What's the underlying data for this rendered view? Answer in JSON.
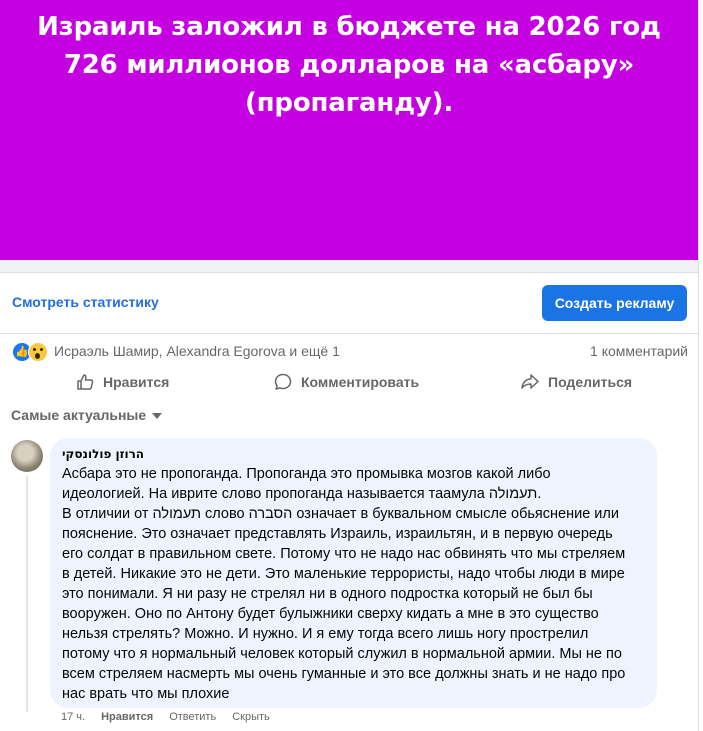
{
  "banner": {
    "color": "#c501e2",
    "line1": "Израиль заложил в бюджете на 2026 год",
    "line2": "726 миллионов долларов на «асбару»",
    "line3": "(пропаганду)."
  },
  "promo": {
    "stats_link": "Смотреть статистику",
    "ad_button": "Создать рекламу",
    "accent": "#1b74e4"
  },
  "reactions": {
    "icons": [
      "like-icon",
      "wow-icon"
    ],
    "reactors_text": "Исраэль Шамир, Alexandra Egorova и ещё 1",
    "comment_count": "1 комментарий"
  },
  "actions": {
    "like": "Нравится",
    "comment": "Комментировать",
    "share": "Поделиться"
  },
  "sort": {
    "label": "Самые актуальные"
  },
  "comment": {
    "author": "הרוזן פולונסקי",
    "text": "Асбара это не пропоганда. Пропоганда это промывка мозгов какой либо\nидеологией. На иврите слово пропоганда называется таамула תעמולה.\nВ отличии от תעמולה слово הסברה означает в буквальном смысле обьяснение или\nпояснение. Это означает представлять Израиль, израильтян, и в первую очередь\nего солдат в правильном свете. Потому что не надо нас обвинять что мы стреляем\nв детей. Никакие это не дети. Это маленькие террористы, надо чтобы люди в мире\nэто понимали. Я ни разу не стрелял ни в одного подростка который не был бы\nвооружен. Оно по Антону будет булыжники сверху кидать а мне в это существо\nнельзя стрелять? Можно. И нужно. И я ему тогда всего лишь ногу прострелил\nпотому что я нормальный человек который служил в нормальной армии. Мы не по\nвсем стреляем насмерть мы очень гуманные и это все должны знать и не надо про\nнас врать что мы плохие",
    "time": "17 ч.",
    "like": "Нравится",
    "reply": "Ответить",
    "hide": "Скрыть"
  }
}
